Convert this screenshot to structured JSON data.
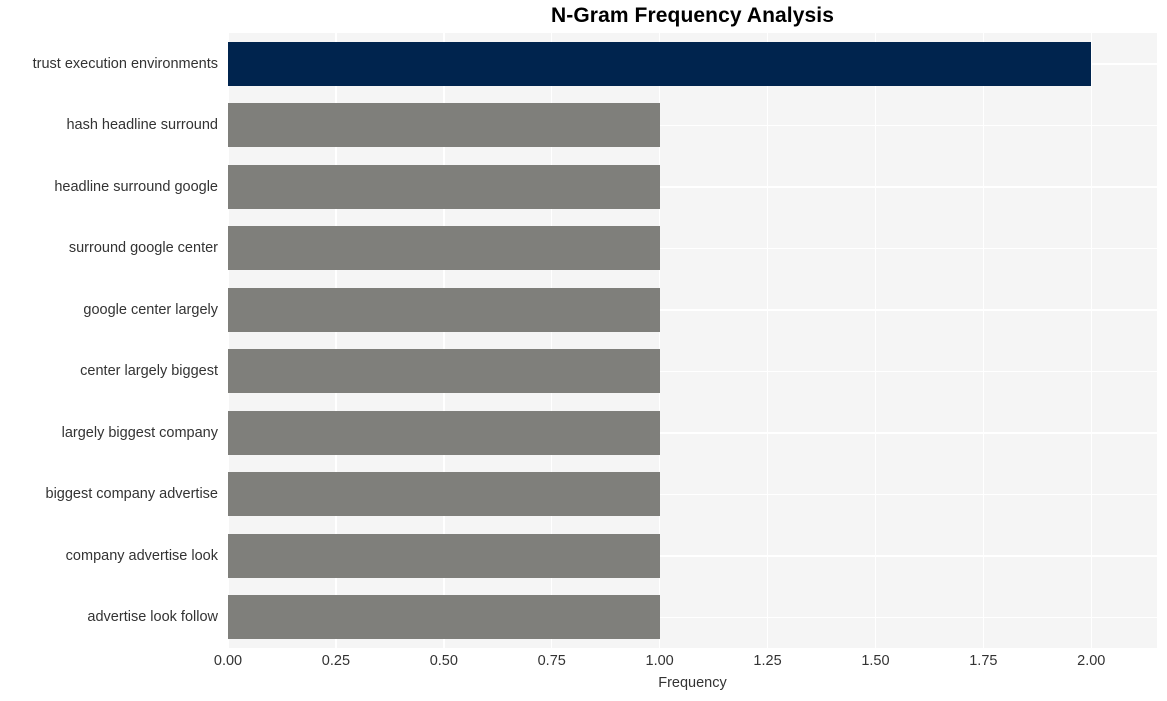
{
  "chart_data": {
    "type": "bar",
    "orientation": "horizontal",
    "title": "N-Gram Frequency Analysis",
    "xlabel": "Frequency",
    "ylabel": "",
    "categories": [
      "trust execution environments",
      "hash headline surround",
      "headline surround google",
      "surround google center",
      "google center largely",
      "center largely biggest",
      "largely biggest company",
      "biggest company advertise",
      "company advertise look",
      "advertise look follow"
    ],
    "values": [
      2,
      1,
      1,
      1,
      1,
      1,
      1,
      1,
      1,
      1
    ],
    "bar_colors": [
      "#00244e",
      "#7f7f7b",
      "#7f7f7b",
      "#7f7f7b",
      "#7f7f7b",
      "#7f7f7b",
      "#7f7f7b",
      "#7f7f7b",
      "#7f7f7b",
      "#7f7f7b"
    ],
    "xlim": [
      0.0,
      2.1523
    ],
    "xticks": [
      0.0,
      0.25,
      0.5,
      0.75,
      1.0,
      1.25,
      1.5,
      1.75,
      2.0
    ],
    "xtick_labels": [
      "0.00",
      "0.25",
      "0.50",
      "0.75",
      "1.00",
      "1.25",
      "1.50",
      "1.75",
      "2.00"
    ],
    "grid": true,
    "grid_color": "#ffffff",
    "plot_background": "#f5f5f5",
    "figure_background": "#ffffff",
    "legend": null,
    "highlight_color": "#00244e",
    "default_bar_color": "#7f7f7b"
  }
}
